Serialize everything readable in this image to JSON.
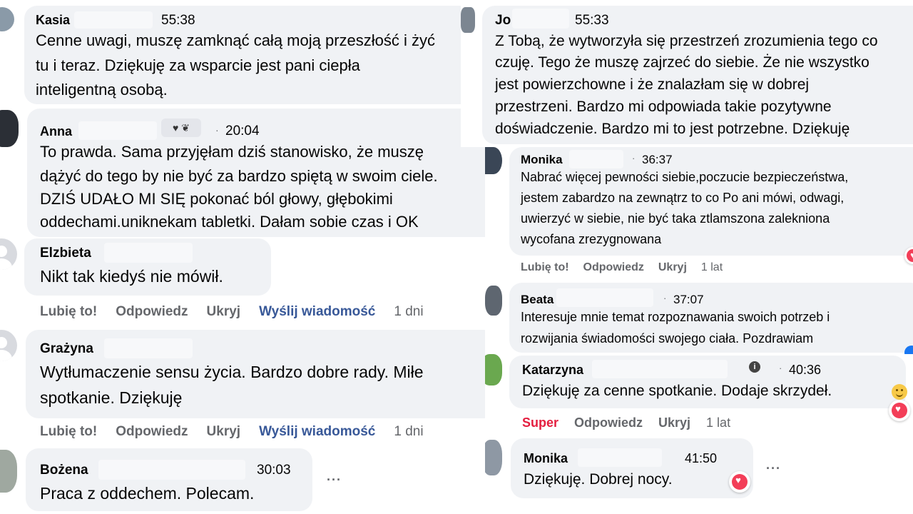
{
  "left": {
    "kasia": {
      "name": "Kasia",
      "time": "55:38",
      "lines": [
        "Cenne uwagi, muszę zamknąć całą moją przeszłość i żyć",
        "tu i teraz. Dziękuję za wsparcie jest pani ciepła",
        "inteligentną osobą."
      ]
    },
    "anna": {
      "name": "Anna",
      "time": "20:04",
      "lines": [
        "To prawda. Sama przyjęłam dziś stanowisko, że muszę",
        "dążyć do tego by nie być za bardzo spiętą w swoim ciele.",
        "DZIŚ UDAŁO MI SIĘ pokonać ból głowy, głębokimi",
        "oddechami.uniknekam tabletki. Dałam sobie czas i OK"
      ]
    },
    "elzbieta": {
      "name": "Elzbieta",
      "lines": [
        "Nikt tak kiedyś nie mówił."
      ],
      "actions": {
        "like": "Lubię to!",
        "reply": "Odpowiedz",
        "hide": "Ukryj",
        "message": "Wyślij wiadomość",
        "age": "1 dni"
      }
    },
    "grazyna": {
      "name": "Grażyna",
      "lines": [
        "Wytłumaczenie sensu życia. Bardzo dobre rady. Miłe",
        "spotkanie. Dziękuję"
      ],
      "actions": {
        "like": "Lubię to!",
        "reply": "Odpowiedz",
        "hide": "Ukryj",
        "message": "Wyślij wiadomość",
        "age": "1 dni"
      }
    },
    "bozena": {
      "name": "Bożena",
      "time": "30:03",
      "lines": [
        "Praca z oddechem. Polecam."
      ],
      "more": "···"
    }
  },
  "right": {
    "jo": {
      "name": "Jo",
      "time": "55:33",
      "lines": [
        "Z Tobą, że wytworzyła się przestrzeń zrozumienia tego co",
        "czuję. Tego że muszę zajrzeć do siebie. Że nie wszystko",
        "jest powierzchowne i że znalazłam się w dobrej",
        "przestrzeni. Bardzo mi odpowiada takie pozytywne",
        "doświadczenie. Bardzo mi to jest potrzebne. Dziękuję"
      ]
    },
    "monika1": {
      "name": "Monika",
      "time": "36:37",
      "lines": [
        "Nabrać więcej pewności siebie,poczucie bezpieczeństwa,",
        "jestem zabardzo na zewnątrz to co Po ani mówi, odwagi,",
        "uwierzyć w siebie, nie być taka ztlamszona zalekniona",
        "wycofana zrezygnowana"
      ],
      "actions": {
        "like": "Lubię to!",
        "reply": "Odpowiedz",
        "hide": "Ukryj",
        "age": "1 lat"
      }
    },
    "beata": {
      "name": "Beata",
      "time": "37:07",
      "lines": [
        "Interesuje mnie temat rozpoznawania swoich potrzeb i",
        "rozwijania świadomości swojego ciała. Pozdrawiam"
      ]
    },
    "katarzyna": {
      "name": "Katarzyna",
      "time": "40:36",
      "lines": [
        "Dziękuję za cenne spotkanie. Dodaje skrzydeł."
      ],
      "actions": {
        "like": "Super",
        "reply": "Odpowiedz",
        "hide": "Ukryj",
        "age": "1 lat"
      }
    },
    "monika2": {
      "name": "Monika",
      "time": "41:50",
      "lines": [
        "Dziękuję. Dobrej nocy."
      ],
      "more": "···"
    }
  },
  "separator": "·",
  "info_symbol": "i",
  "badge_icons": "♥ ❦",
  "icons": [
    "heart-reaction-icon",
    "like-reaction-icon",
    "more-icon",
    "info-icon",
    "smile-emoji-icon",
    "default-avatar-icon"
  ],
  "colors": {
    "bubble": "#f0f2f5",
    "name": "#050505",
    "meta": "#65676b",
    "link": "#385898",
    "super": "#e41e3f",
    "heart": "#f33e58",
    "like": "#1877f2"
  }
}
